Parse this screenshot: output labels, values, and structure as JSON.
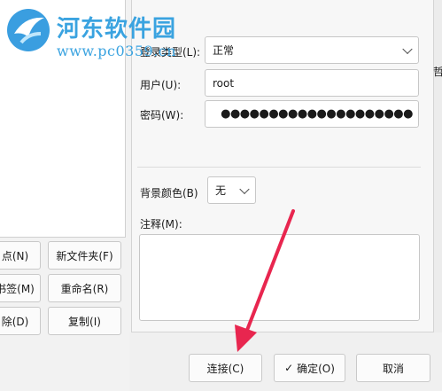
{
  "watermark": {
    "name": "河东软件园",
    "url": "www.pc0359.cn"
  },
  "left_buttons": {
    "add_site": "点(N)",
    "new_folder": "新文件夹(F)",
    "bookmark": "书签(M)",
    "rename": "重命名(R)",
    "delete": "除(D)",
    "copy": "复制(I)"
  },
  "form": {
    "login_type_label": "登录类型(L):",
    "login_type_value": "正常",
    "user_label": "用户(U):",
    "user_value": "root",
    "password_label": "密码(W):",
    "password_value": "●●●●●●●●●●●●●●●●●●●●",
    "bg_color_label": "背景颜色(B)",
    "bg_color_value": "无",
    "comment_label": "注释(M):",
    "comment_value": ""
  },
  "right_strip_text": "哲",
  "dialog_buttons": {
    "connect": "连接(C)",
    "ok_check": "✓",
    "ok": "确定(O)",
    "cancel": "取消"
  },
  "colors": {
    "arrow": "#e8264f",
    "watermark": "#3aa3e0"
  }
}
